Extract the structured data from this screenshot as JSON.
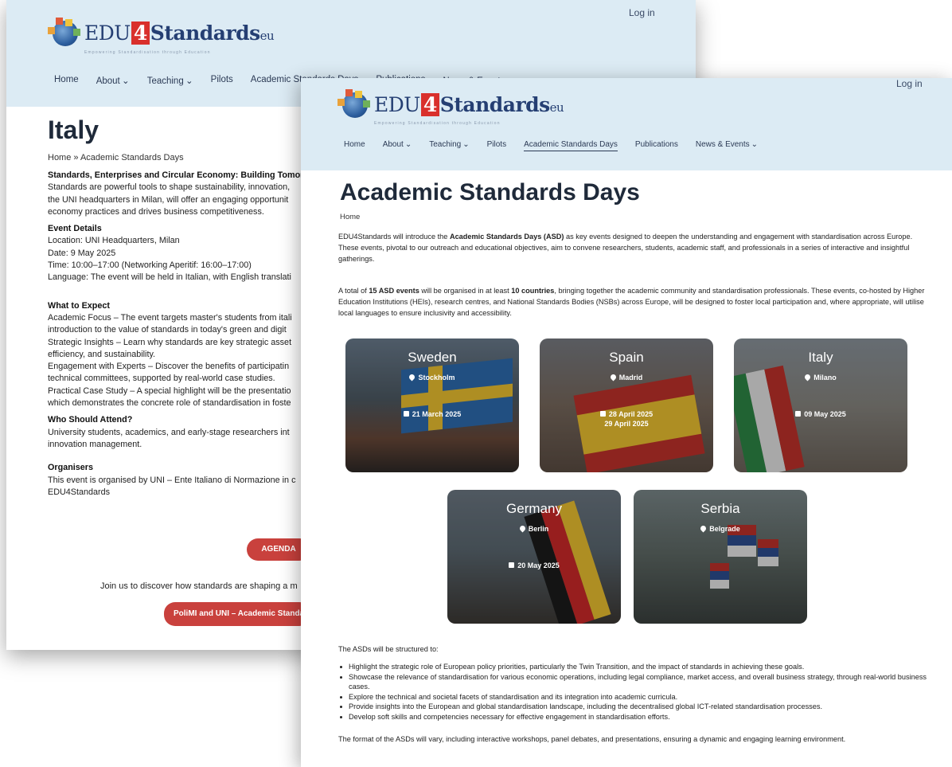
{
  "site": {
    "logo_text_a": "EDU",
    "logo_text_b": "4",
    "logo_text_c": "Standards",
    "logo_text_d": "eu",
    "tagline": "Empowering Standardisation through Education",
    "login": "Log in",
    "nav": [
      "Home",
      "About ⌄",
      "Teaching ⌄",
      "Pilots",
      "Academic Standards Days",
      "Publications",
      "News & Events ⌄"
    ]
  },
  "italy_page": {
    "title": "Italy",
    "breadcrumb": "Home » Academic Standards Days",
    "intro_heading": "Standards, Enterprises and Circular Economy: Building Tomor",
    "intro_lines": [
      "Standards are powerful tools to shape sustainability, innovation,",
      "the UNI headquarters in Milan, will offer an engaging opportunit",
      "economy practices and drives business competitiveness."
    ],
    "details_heading": "Event Details",
    "details_lines": [
      "Location: UNI Headquarters, Milan",
      "Date: 9 May 2025",
      "Time: 10:00–17:00 (Networking Aperitif: 16:00–17:00)",
      "Language: The event will be held in Italian, with English translati"
    ],
    "expect_heading": "What to Expect",
    "expect_lines": [
      "Academic Focus – The event targets master's students from itali",
      "introduction to the value of standards in today's green and digit",
      "Strategic Insights – Learn why standards are key strategic asset",
      "efficiency, and sustainability.",
      "Engagement with Experts – Discover the benefits of participatin",
      "technical committees, supported by real-world case studies.",
      "Practical Case Study – A special highlight will be the presentatio",
      "which demonstrates the concrete role of standardisation in foste"
    ],
    "attend_heading": "Who Should Attend?",
    "attend_lines": [
      "University students, academics, and early-stage researchers int",
      "innovation management."
    ],
    "org_heading": "Organisers",
    "org_lines": [
      "This event is organised by UNI – Ente Italiano di Normazione in c",
      "EDU4Standards"
    ],
    "agenda_button": "AGENDA",
    "join_text": "Join us to discover how standards are shaping a m",
    "polimi_button": "PoliMI and UNI – Academic Standa"
  },
  "asd_page": {
    "title": "Academic Standards Days",
    "breadcrumb": "Home",
    "p1_a": "EDU4Standards will introduce the ",
    "p1_b": "Academic Standards Days (ASD)",
    "p1_c": " as key events designed to deepen the understanding and engagement with standardisation across Europe. These events, pivotal to our outreach and educational objectives, aim to convene researchers, students, academic staff, and professionals in a series of interactive and insightful gatherings.",
    "p2_a": "A total of ",
    "p2_b": "15 ASD events",
    "p2_c": " will be organised in at least ",
    "p2_d": "10 countries",
    "p2_e": ", bringing together the academic community and standardisation professionals. These events, co-hosted by Higher Education Institutions (HEIs), research centres, and National Standards Bodies (NSBs) across Europe, will be designed to foster local participation and, where appropriate, will utilise local languages to ensure inclusivity and accessibility.",
    "cards": [
      {
        "country": "Sweden",
        "city": "Stockholm",
        "date1": "21 March 2025",
        "date2": ""
      },
      {
        "country": "Spain",
        "city": "Madrid",
        "date1": "28 April 2025",
        "date2": "29 April 2025"
      },
      {
        "country": "Italy",
        "city": "Milano",
        "date1": "09 May 2025",
        "date2": ""
      },
      {
        "country": "Germany",
        "city": "Berlin",
        "date1": "20 May 2025",
        "date2": ""
      },
      {
        "country": "Serbia",
        "city": "Belgrade",
        "date1": "",
        "date2": ""
      }
    ],
    "structured_intro": "The ASDs will be structured to:",
    "bullets": [
      "Highlight the strategic role of European policy priorities, particularly the Twin Transition, and the impact of standards in achieving these goals.",
      "Showcase the relevance of standardisation for various economic operations, including legal compliance, market access, and overall business strategy, through real-world business cases.",
      "Explore the technical and societal facets of standardisation and its integration into academic curricula.",
      "Provide insights into the European and global standardisation landscape, including the decentralised global ICT-related standardisation processes.",
      "Develop soft skills and competencies necessary for effective engagement in standardisation efforts."
    ],
    "closing": "The format of the ASDs will vary, including interactive workshops, panel debates, and presentations, ensuring a dynamic and engaging learning environment."
  },
  "colors": {
    "header_bg": "#dcebf4",
    "brand_red": "#d9302c",
    "button_red": "#c9413d",
    "brand_navy": "#253f73"
  }
}
